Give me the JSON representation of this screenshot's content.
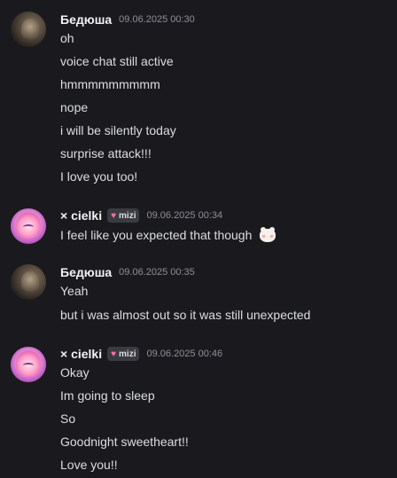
{
  "messages": [
    {
      "username": "Бедюша",
      "timestamp": "09.06.2025 00:30",
      "avatar": "dark-photo-avatar",
      "lines": [
        "oh",
        "voice chat still active",
        "hmmmmmmmmm",
        "nope",
        "i will be silently today",
        "surprise attack!!!",
        "I love you too!"
      ]
    },
    {
      "username": "× cielki",
      "tag": "mizi",
      "timestamp": "09.06.2025 00:34",
      "avatar": "pink-anime-avatar",
      "lines": [
        "I feel like you expected that though"
      ],
      "sticker": "cat-sticker-icon"
    },
    {
      "username": "Бедюша",
      "timestamp": "09.06.2025 00:35",
      "avatar": "dark-photo-avatar",
      "lines": [
        "Yeah",
        "but i was almost out so it was still unexpected"
      ]
    },
    {
      "username": "× cielki",
      "tag": "mizi",
      "timestamp": "09.06.2025 00:46",
      "avatar": "pink-anime-avatar",
      "lines": [
        "Okay",
        "Im going to sleep",
        "So",
        "Goodnight sweetheart!!",
        "Love you!!"
      ]
    }
  ],
  "colors": {
    "background": "#1a1a1e",
    "text": "#dbdee1",
    "username": "#f2f3f5",
    "timestamp": "#8d9096",
    "tag_bg": "#3a3b40",
    "heart": "#ff6fae"
  }
}
